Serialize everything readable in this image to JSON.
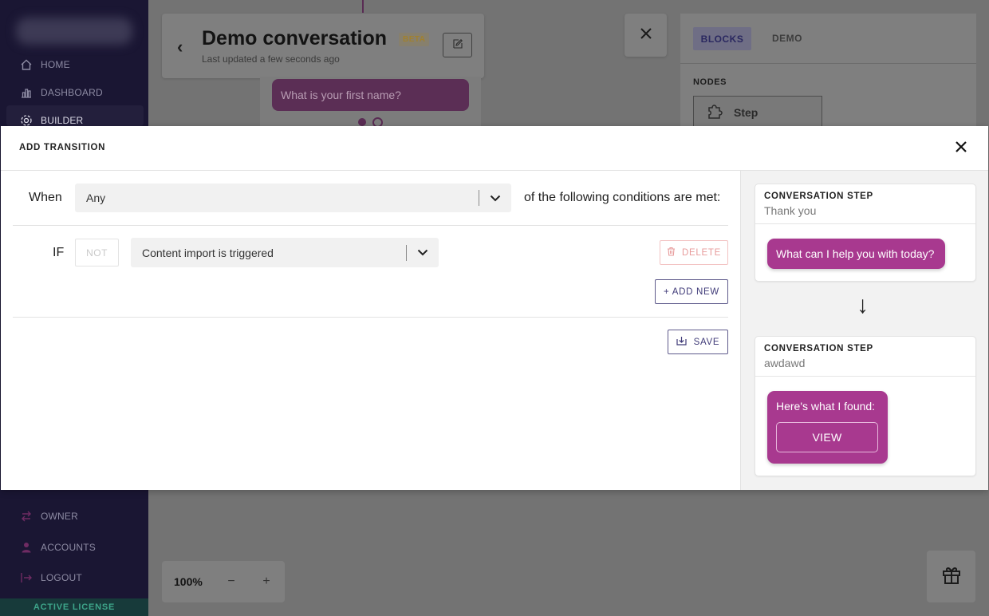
{
  "sidebar": {
    "items": [
      {
        "label": "HOME",
        "icon": "home-icon"
      },
      {
        "label": "DASHBOARD",
        "icon": "chart-icon"
      },
      {
        "label": "BUILDER",
        "icon": "builder-icon"
      },
      {
        "label": "OWNER",
        "icon": "swap-icon"
      },
      {
        "label": "ACCOUNTS",
        "icon": "user-icon"
      },
      {
        "label": "LOGOUT",
        "icon": "logout-icon"
      }
    ],
    "license": "ACTIVE LICENSE"
  },
  "header": {
    "title": "Demo conversation",
    "badge": "BETA",
    "updated": "Last updated a few seconds ago"
  },
  "canvas": {
    "node_bubble": "What is your first name?",
    "zoom": "100%",
    "zoom_out": "−",
    "zoom_in": "+"
  },
  "right_panel": {
    "tabs": [
      "BLOCKS",
      "DEMO"
    ],
    "nodes_label": "NODES",
    "step_label": "Step"
  },
  "modal": {
    "title": "ADD TRANSITION",
    "when_label": "When",
    "when_value": "Any",
    "conditions_text": "of the following conditions are met:",
    "if_label": "IF",
    "not_label": "NOT",
    "condition_value": "Content import is triggered",
    "delete_label": "DELETE",
    "add_new_label": "+ ADD NEW",
    "save_label": "SAVE"
  },
  "preview": {
    "steps": [
      {
        "kind": "CONVERSATION STEP",
        "name": "Thank you",
        "message": "What can I help you with today?"
      },
      {
        "kind": "CONVERSATION STEP",
        "name": "awdawd",
        "message": "Here's what I found:",
        "button": "VIEW"
      }
    ],
    "arrow": "↓"
  },
  "colors": {
    "accent": "#a8398f",
    "primary_outline": "#5f5b8c",
    "danger_outline": "#f3c3c3",
    "sidebar_bg": "#1a1633"
  }
}
